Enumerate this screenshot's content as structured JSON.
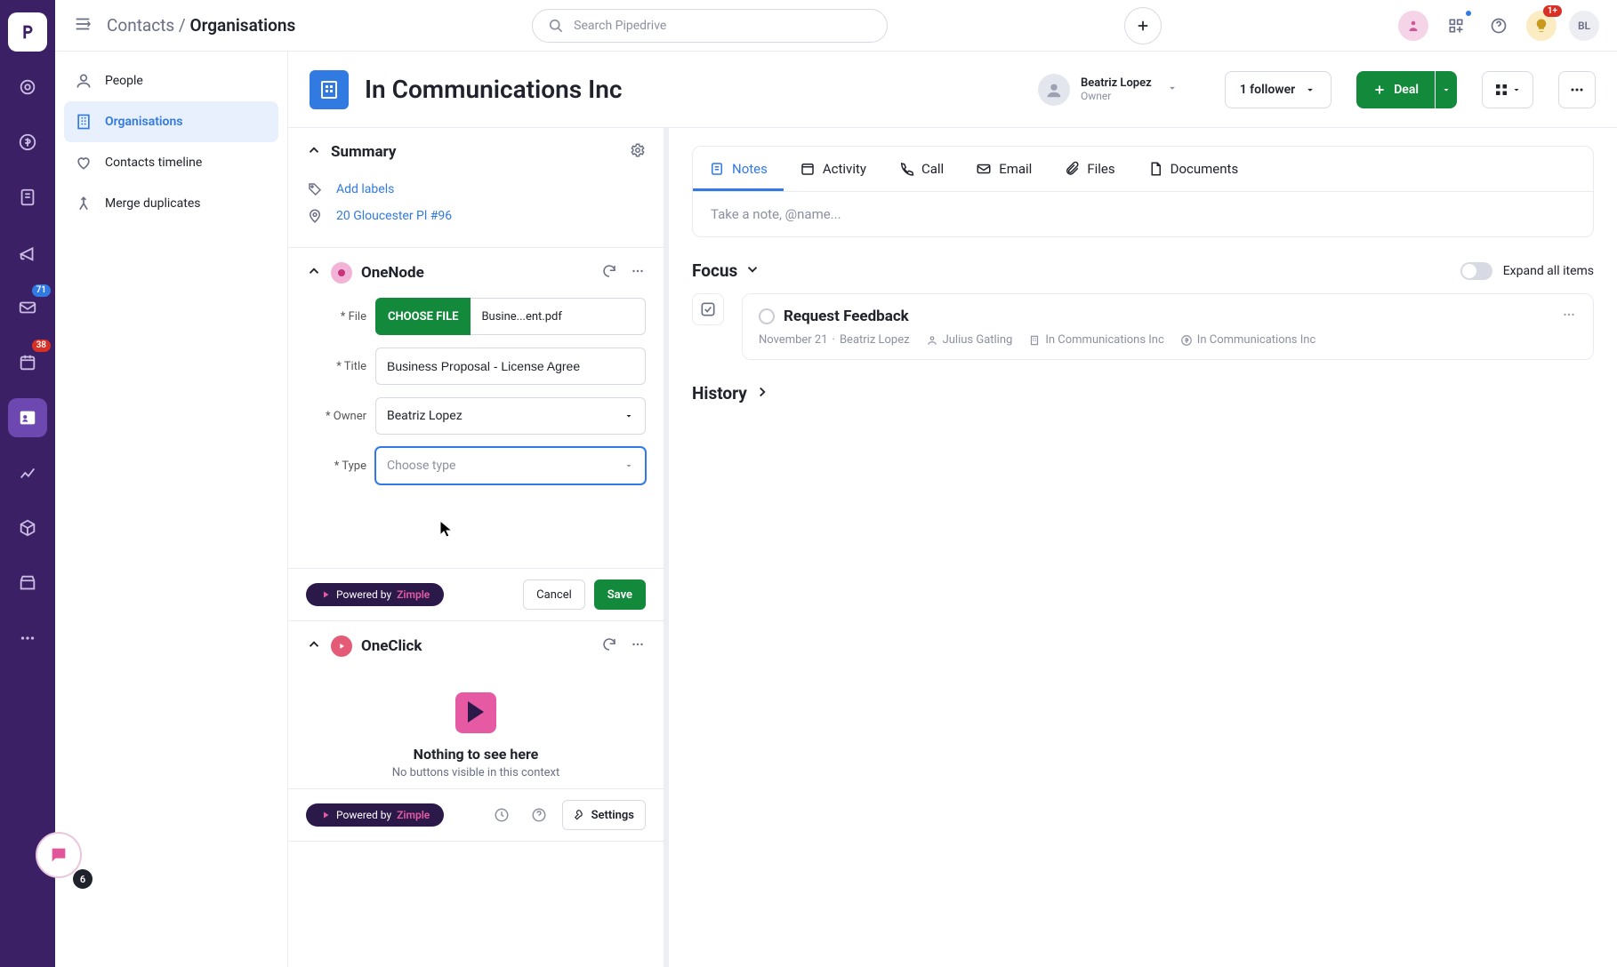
{
  "topbar": {
    "breadcrumb_parent": "Contacts",
    "breadcrumb_sep": " / ",
    "breadcrumb_current": "Organisations",
    "search_placeholder": "Search Pipedrive",
    "user_initials": "BL",
    "bulb_badge": "1+"
  },
  "rail": {
    "inbox_badge": "71",
    "cal_badge": "38",
    "fab_count": "6"
  },
  "sub_sidebar": {
    "items": [
      {
        "label": "People"
      },
      {
        "label": "Organisations"
      },
      {
        "label": "Contacts timeline"
      },
      {
        "label": "Merge duplicates"
      }
    ]
  },
  "header": {
    "title": "In Communications Inc",
    "owner_name": "Beatriz Lopez",
    "owner_role": "Owner",
    "follower_label": "1 follower",
    "deal_label": "Deal"
  },
  "summary": {
    "title": "Summary",
    "add_labels": "Add labels",
    "address": "20 Gloucester Pl #96"
  },
  "onenode": {
    "title": "OneNode",
    "file_label": "* File",
    "choose_file": "CHOOSE FILE",
    "file_name": "Busine...ent.pdf",
    "title_label": "* Title",
    "title_value": "Business Proposal - License Agree",
    "owner_label": "* Owner",
    "owner_value": "Beatriz Lopez",
    "type_label": "* Type",
    "type_placeholder": "Choose type",
    "powered_by": "Powered by ",
    "zimple": "Zimple",
    "cancel": "Cancel",
    "save": "Save"
  },
  "oneclick": {
    "title": "OneClick",
    "empty_title": "Nothing to see here",
    "empty_sub": "No buttons visible in this context",
    "powered_by": "Powered by ",
    "zimple": "Zimple",
    "settings": "Settings"
  },
  "tabs": {
    "items": [
      {
        "label": "Notes"
      },
      {
        "label": "Activity"
      },
      {
        "label": "Call"
      },
      {
        "label": "Email"
      },
      {
        "label": "Files"
      },
      {
        "label": "Documents"
      }
    ],
    "note_placeholder": "Take a note, @name..."
  },
  "focus": {
    "title": "Focus",
    "expand": "Expand all items",
    "card_title": "Request Feedback",
    "date": "November 21",
    "sep": " · ",
    "author": "Beatriz Lopez",
    "assignee": "Julius Gatling",
    "org1": "In Communications Inc",
    "org2": "In Communications Inc"
  },
  "history": {
    "title": "History"
  }
}
